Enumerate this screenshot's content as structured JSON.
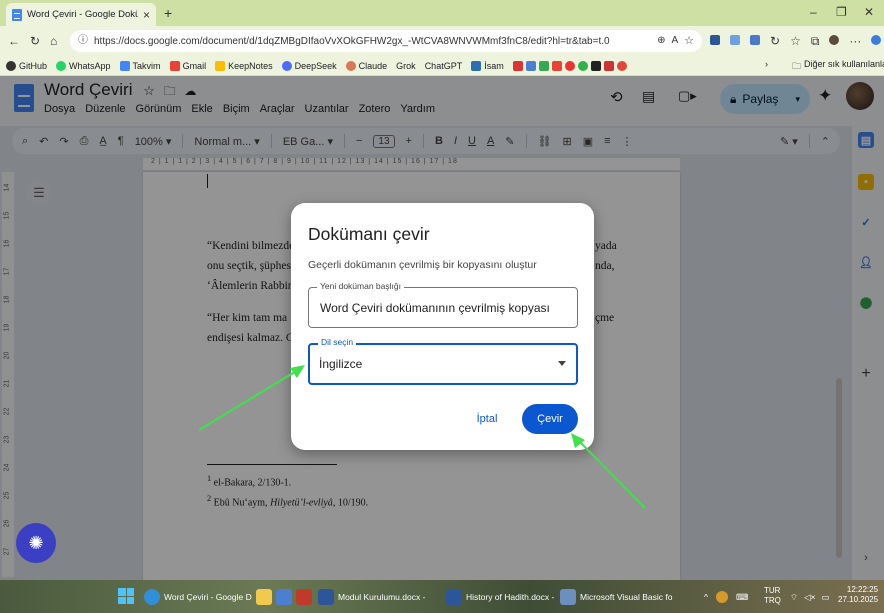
{
  "browser": {
    "tab_title": "Word Çeviri - Google Dokümanla",
    "url": "https://docs.google.com/document/d/1dqZMBgDIfaoVvXOkGFHW2gx_-WtCVA8WNVWMmf3fnC8/edit?hl=tr&tab=t.0",
    "bookmarks": [
      "GitHub",
      "WhatsApp",
      "Takvim",
      "Gmail",
      "KeepNotes",
      "DeepSeek",
      "Claude",
      "Grok",
      "ChatGPT",
      "İsam"
    ],
    "other_bookmarks": "Diğer sık kullanılanlar"
  },
  "docs": {
    "title": "Word Çeviri",
    "menus": [
      "Dosya",
      "Düzenle",
      "Görünüm",
      "Ekle",
      "Biçim",
      "Araçlar",
      "Uzantılar",
      "Zotero",
      "Yardım"
    ],
    "share_label": "Paylaş",
    "toolbar": {
      "zoom": "100%",
      "style": "Normal m...",
      "font": "EB Ga...",
      "font_size": "13",
      "bold": "B",
      "italic": "I",
      "underline": "U",
      "text_color": "A"
    },
    "ruler": "2 | 1 | 1 | 2 | 3 | 4 | 5 | 6 | 7 | 8 | 9 | 10 | 11 | 12 | 13 | 14 | 15 | 16 | 17 | 18",
    "vruler": [
      "14",
      "15",
      "16",
      "17",
      "18",
      "19",
      "20",
      "21",
      "22",
      "23",
      "24",
      "25",
      "26",
      "27"
    ]
  },
  "document": {
    "para1_lines": [
      "“Kendini bilmezde",
      "onu seçtik, şüphes",
      "‘Âlemlerin Rabbin"
    ],
    "para1_right": [
      "yada",
      "nda,"
    ],
    "para2_lines": [
      "“Her kim tam ma",
      "endişesi kalmaz. Gö"
    ],
    "para2_right": [
      "çme"
    ],
    "footnote1_num": "1",
    "footnote1": "el-Bakara, 2/130-1.",
    "footnote2_num": "2",
    "footnote2_a": "Ebû Nu‘aym, ",
    "footnote2_b": "Hilyetü’l-evliyâ",
    "footnote2_c": ", 10/190."
  },
  "dialog": {
    "title": "Dokümanı çevir",
    "subtitle": "Geçerli dokümanın çevrilmiş bir kopyasını oluştur",
    "name_label": "Yeni doküman başlığı",
    "name_value": "Word Çeviri dokümanının çevrilmiş kopyası",
    "lang_label": "Dil seçin",
    "lang_value": "İngilizce",
    "cancel_label": "İptal",
    "translate_label": "Çevir"
  },
  "taskbar": {
    "items": [
      "Word Çeviri - Google D",
      "Modul Kurulumu.docx -",
      "History of Hadith.docx -",
      "Microsoft Visual Basic fo"
    ],
    "lang": "TUR",
    "lang2": "TRQ",
    "time": "12:22:25",
    "date": "27.10.2025"
  },
  "colors": {
    "accent": "#0b57d0",
    "arrow": "#3ee24a"
  }
}
